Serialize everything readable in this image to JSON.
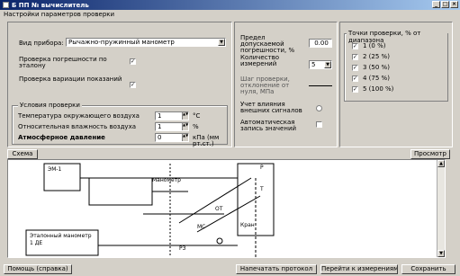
{
  "window": {
    "title": "Б ПП  № вычислитель",
    "controls": [
      "_",
      "□",
      "×"
    ]
  },
  "menu": {
    "item": "Настройки параметров проверки"
  },
  "form": {
    "device_type_label": "Вид прибора:",
    "device_type_value": "Рычажно-пружинный манометр",
    "opt1_label": "Проверка погрешности по эталону",
    "opt1_checked": "✓",
    "opt2_label": "Проверка вариации показаний",
    "opt2_checked": "✓",
    "check_group_title": "Условия проверки",
    "temp_label": "Температура окружающего воздуха",
    "temp_value": "1",
    "temp_unit": "°С",
    "humidity_label": "Относительная влажность воздуха",
    "humidity_value": "1",
    "humidity_unit": "%",
    "pressure_label": "Атмосферное давление",
    "pressure_value": "0",
    "pressure_unit": "кПа (мм рт.ст.)"
  },
  "mid": {
    "limit_label": "Предел допускаемой погрешности, %",
    "limit_value": "0.00",
    "count_label": "Количество измерений",
    "count_value": "5",
    "step_label": "Шаг проверки, отклонение от нуля, МПа",
    "influence_label": "Учет влияния внешних сигналов",
    "auto_label": "Автоматическая запись значений"
  },
  "points": {
    "title": "Точки проверки, % от диапазона",
    "items": [
      "1 (0 %)",
      "2 (25 %)",
      "3 (50 %)",
      "4 (75 %)",
      "5 (100 %)"
    ]
  },
  "diagram": {
    "left_btn": "Схема",
    "right_btn": "Просмотр",
    "labels": [
      "ЭМ-1",
      "Манометр",
      "Р",
      "Т",
      "Эталонный манометр",
      "1 ДЕ",
      "РЗ",
      "МС",
      "ОТ",
      "Кран"
    ]
  },
  "footer": {
    "help": "Помощь (справка)",
    "print": "Напечатать протокол",
    "next": "Перейти к измерениям",
    "save": "Сохранить"
  }
}
